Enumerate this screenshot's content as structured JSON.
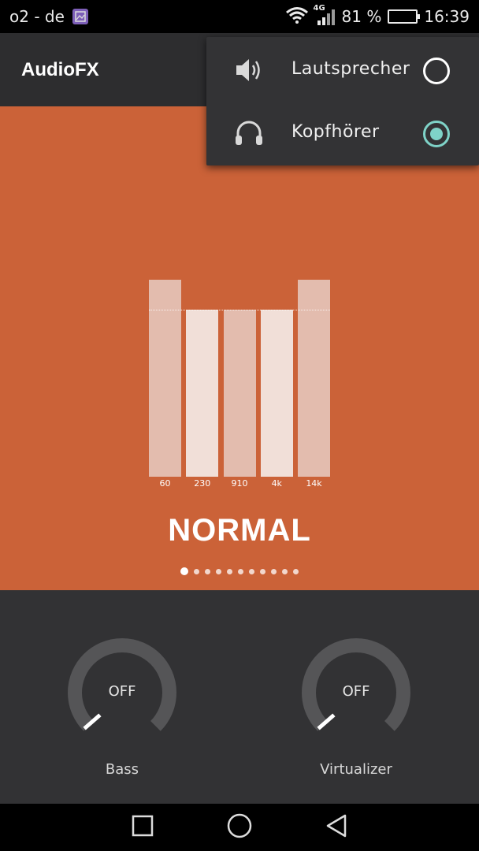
{
  "status_bar": {
    "carrier": "o2 - de",
    "network": "4G",
    "battery_percent": "81 %",
    "battery_level": 0.81,
    "time": "16:39"
  },
  "app_bar": {
    "title": "AudioFX"
  },
  "output_menu": {
    "items": [
      {
        "label": "Lautsprecher",
        "icon": "speaker-icon",
        "selected": false
      },
      {
        "label": "Kopfhörer",
        "icon": "headphones-icon",
        "selected": true
      }
    ],
    "accent_color": "#7fd3c8"
  },
  "equalizer": {
    "background_color": "#cb6238",
    "bands": [
      {
        "label": "60",
        "level": 1.0
      },
      {
        "label": "230",
        "level": 0.85
      },
      {
        "label": "910",
        "level": 0.85
      },
      {
        "label": "4k",
        "level": 0.85
      },
      {
        "label": "14k",
        "level": 1.0
      }
    ],
    "preset_name": "NORMAL",
    "page_count": 11,
    "active_page": 0
  },
  "effects": {
    "bass": {
      "label": "Bass",
      "value": "OFF",
      "level": 0
    },
    "virtualizer": {
      "label": "Virtualizer",
      "value": "OFF",
      "level": 0
    }
  },
  "nav_bar": {
    "icons": [
      "recents-icon",
      "home-icon",
      "back-icon"
    ]
  }
}
